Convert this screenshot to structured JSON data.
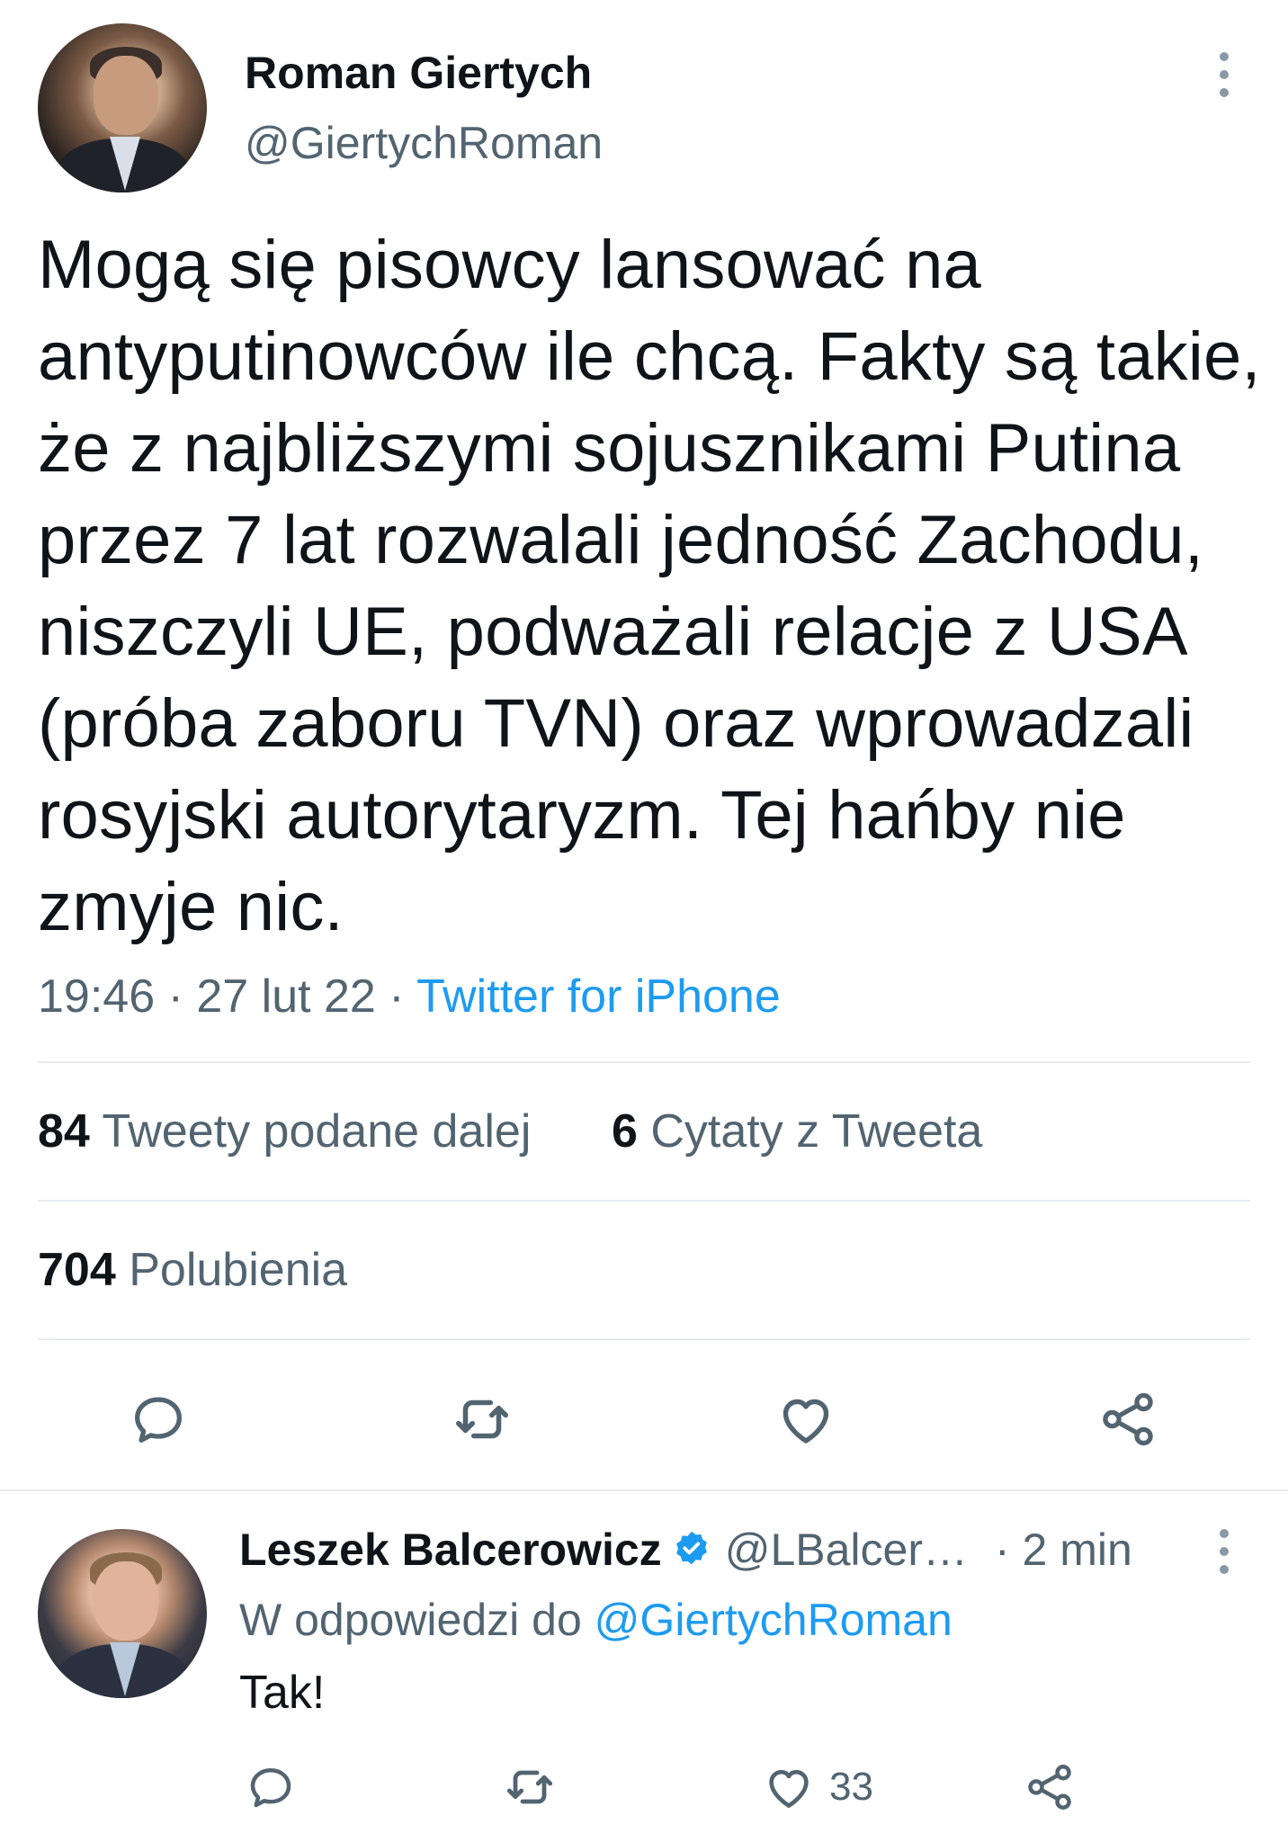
{
  "main_tweet": {
    "author": {
      "name": "Roman Giertych",
      "handle": "@GiertychRoman"
    },
    "text": "Mogą się pisowcy lansować na antyputinowców ile chcą. Fakty są takie, że z najbliższymi sojusznikami Putina przez 7 lat rozwalali jedność Zachodu, niszczyli UE, podważali relacje z USA (próba zaboru TVN) oraz wprowadzali rosyjski autorytaryzm. Tej hańby nie zmyje nic.",
    "time": "19:46",
    "sep": " · ",
    "date": "27 lut 22",
    "source": "Twitter for iPhone",
    "stats": {
      "retweets_count": "84",
      "retweets_label": "Tweety podane dalej",
      "quotes_count": "6",
      "quotes_label": "Cytaty z Tweeta",
      "likes_count": "704",
      "likes_label": "Polubienia"
    },
    "actions": [
      "reply-icon",
      "retweet-icon",
      "like-icon",
      "share-icon"
    ]
  },
  "reply_tweet": {
    "author": {
      "name": "Leszek Balcerowicz",
      "verified": true,
      "handle": "@LBalcer…"
    },
    "time": "· 2 min",
    "reply_prefix": "W odpowiedzi do",
    "reply_mention": "@GiertychRoman",
    "text": "Tak!",
    "like_count": "33",
    "actions": [
      "reply-icon",
      "retweet-icon",
      "like-icon",
      "share-icon"
    ]
  },
  "colors": {
    "accent": "#1d9bf0",
    "secondary_text": "#536471",
    "primary_text": "#0f1419",
    "divider": "#e6ecf0"
  }
}
